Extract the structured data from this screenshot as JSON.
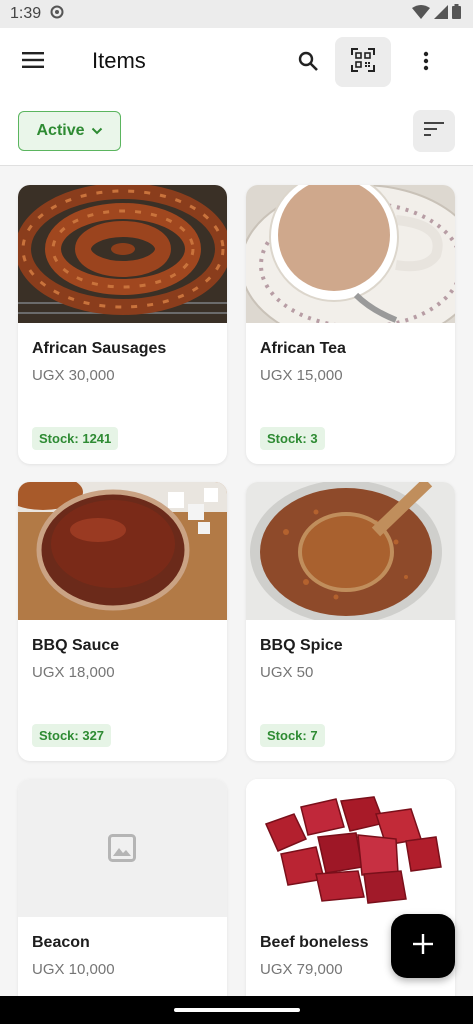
{
  "status_bar": {
    "time": "1:39"
  },
  "app_bar": {
    "title": "Items"
  },
  "filter": {
    "label": "Active"
  },
  "items": [
    {
      "name": "African Sausages",
      "price": "UGX 30,000",
      "stock": "Stock: 1241",
      "image": "sausage-photo"
    },
    {
      "name": "African Tea",
      "price": "UGX 15,000",
      "stock": "Stock: 3",
      "image": "tea-photo"
    },
    {
      "name": "BBQ Sauce",
      "price": "UGX 18,000",
      "stock": "Stock: 327",
      "image": "sauce-photo"
    },
    {
      "name": "BBQ Spice",
      "price": "UGX 50",
      "stock": "Stock: 7",
      "image": "spice-photo"
    },
    {
      "name": "Beacon",
      "price": "UGX 10,000",
      "stock": "",
      "image": "image-placeholder-icon"
    },
    {
      "name": "Beef boneless",
      "price": "UGX 79,000",
      "stock": "",
      "image": "beef-photo"
    }
  ],
  "colors": {
    "accent": "#2e8b33",
    "chip_bg": "#eaf6ea",
    "fab": "#000000"
  }
}
